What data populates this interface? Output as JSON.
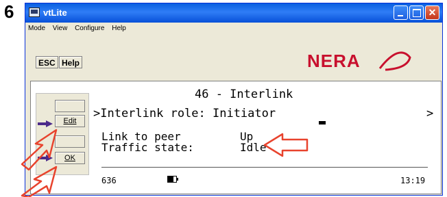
{
  "step_number": "6",
  "window": {
    "title": "vtLite",
    "controls": [
      "minimize",
      "maximize",
      "close"
    ]
  },
  "menu": [
    "Mode",
    "View",
    "Configure",
    "Help"
  ],
  "toolbar": {
    "esc_label": "ESC",
    "help_label": "Help"
  },
  "logo_text": "NERA",
  "softkeys": {
    "edit": "Edit",
    "ok": "OK"
  },
  "display": {
    "title": "46 - Interlink",
    "role_line": ">Interlink role: Initiator",
    "more_arrow": ">",
    "link_label": "Link to peer",
    "link_value": "Up",
    "traffic_label": "Traffic state:",
    "traffic_value": "Idle",
    "footer_number": "636",
    "clock": "13:19"
  },
  "colors": {
    "titlebar": "#0a5fe0",
    "annotation_arrow": "#e8432d",
    "pointer_arrow": "#4b2a8a",
    "logo": "#c8102e"
  }
}
